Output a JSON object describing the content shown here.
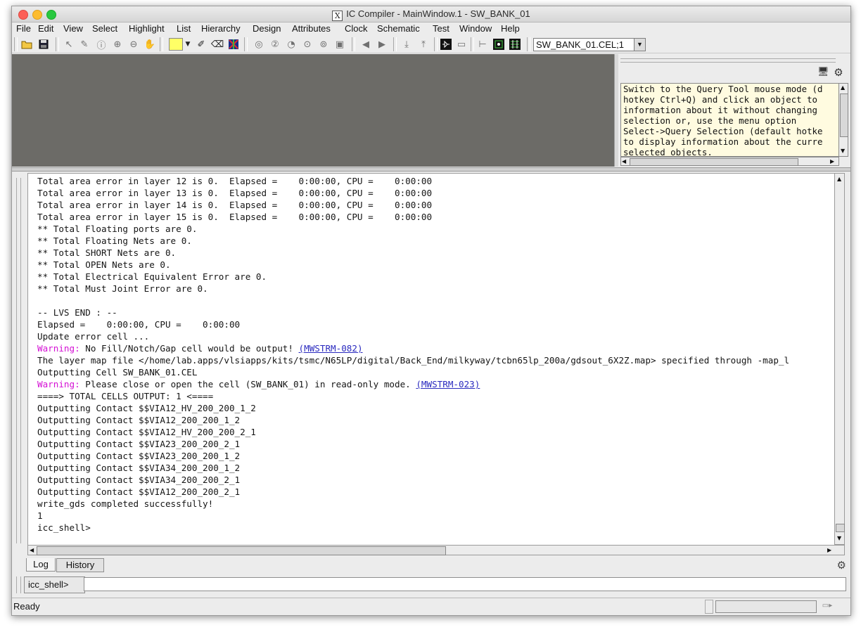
{
  "window": {
    "title": "IC Compiler - MainWindow.1 - SW_BANK_01",
    "app_icon_glyph": "X"
  },
  "menubar": [
    "File",
    "Edit",
    "View",
    "Select",
    "Highlight",
    "List",
    "Hierarchy",
    "Design",
    "Attributes",
    "Clock",
    "Schematic",
    "Test",
    "Window",
    "Help"
  ],
  "toolbar": {
    "cell_combo_value": "SW_BANK_01.CEL;1",
    "color_swatch": "#ffff66",
    "icons": [
      "open-folder-icon",
      "save-icon",
      "select-arrow-icon",
      "pencil-icon",
      "info-icon",
      "zoom-in-icon",
      "zoom-out-icon",
      "pan-hand-icon",
      "color-swatch-icon",
      "highlight-pen-icon",
      "clear-highlight-icon",
      "route-icon",
      "zoom-fit-icon",
      "zoom-2-icon",
      "zoom-half-icon",
      "zoom-box-icon",
      "zoom-sel-icon",
      "zoom-full-icon",
      "back-icon",
      "forward-icon",
      "push-down-icon",
      "pop-up-icon",
      "schematic-icon",
      "layout-icon",
      "ruler-icon",
      "layer-view-icon",
      "net-view-icon"
    ]
  },
  "query_panel": {
    "text": "Switch to the Query Tool mouse mode (d\nhotkey Ctrl+Q) and click an object to\ninformation about it without changing\nselection or, use the menu option\nSelect->Query Selection (default hotke\nto display information about the curre\nselected objects.",
    "icons": [
      "monitor-icon",
      "gear-icon"
    ]
  },
  "log": {
    "lines_before_warning1": "Total area error in layer 12 is 0.  Elapsed =    0:00:00, CPU =    0:00:00\nTotal area error in layer 13 is 0.  Elapsed =    0:00:00, CPU =    0:00:00\nTotal area error in layer 14 is 0.  Elapsed =    0:00:00, CPU =    0:00:00\nTotal area error in layer 15 is 0.  Elapsed =    0:00:00, CPU =    0:00:00\n** Total Floating ports are 0.\n** Total Floating Nets are 0.\n** Total SHORT Nets are 0.\n** Total OPEN Nets are 0.\n** Total Electrical Equivalent Error are 0.\n** Total Must Joint Error are 0.\n\n-- LVS END : --\nElapsed =    0:00:00, CPU =    0:00:00\nUpdate error cell ...",
    "warning_label": "Warning:",
    "warning1_text": " No Fill/Notch/Gap cell would be output! ",
    "warning1_link": "(MWSTRM-082)",
    "lines_between": "The layer map file </home/lab.apps/vlsiapps/kits/tsmc/N65LP/digital/Back_End/milkyway/tcbn65lp_200a/gdsout_6X2Z.map> specified through -map_l\nOutputting Cell SW_BANK_01.CEL",
    "warning2_text": " Please close or open the cell (SW_BANK_01) in read-only mode. ",
    "warning2_link": "(MWSTRM-023)",
    "lines_after": "====> TOTAL CELLS OUTPUT: 1 <====\nOutputting Contact $$VIA12_HV_200_200_1_2\nOutputting Contact $$VIA12_200_200_1_2\nOutputting Contact $$VIA12_HV_200_200_2_1\nOutputting Contact $$VIA23_200_200_2_1\nOutputting Contact $$VIA23_200_200_1_2\nOutputting Contact $$VIA34_200_200_1_2\nOutputting Contact $$VIA34_200_200_2_1\nOutputting Contact $$VIA12_200_200_2_1\nwrite_gds completed successfully!\n1\nicc_shell>"
  },
  "tabs": [
    "Log",
    "History"
  ],
  "command": {
    "prompt": "icc_shell>",
    "value": ""
  },
  "status": {
    "text": "Ready"
  }
}
